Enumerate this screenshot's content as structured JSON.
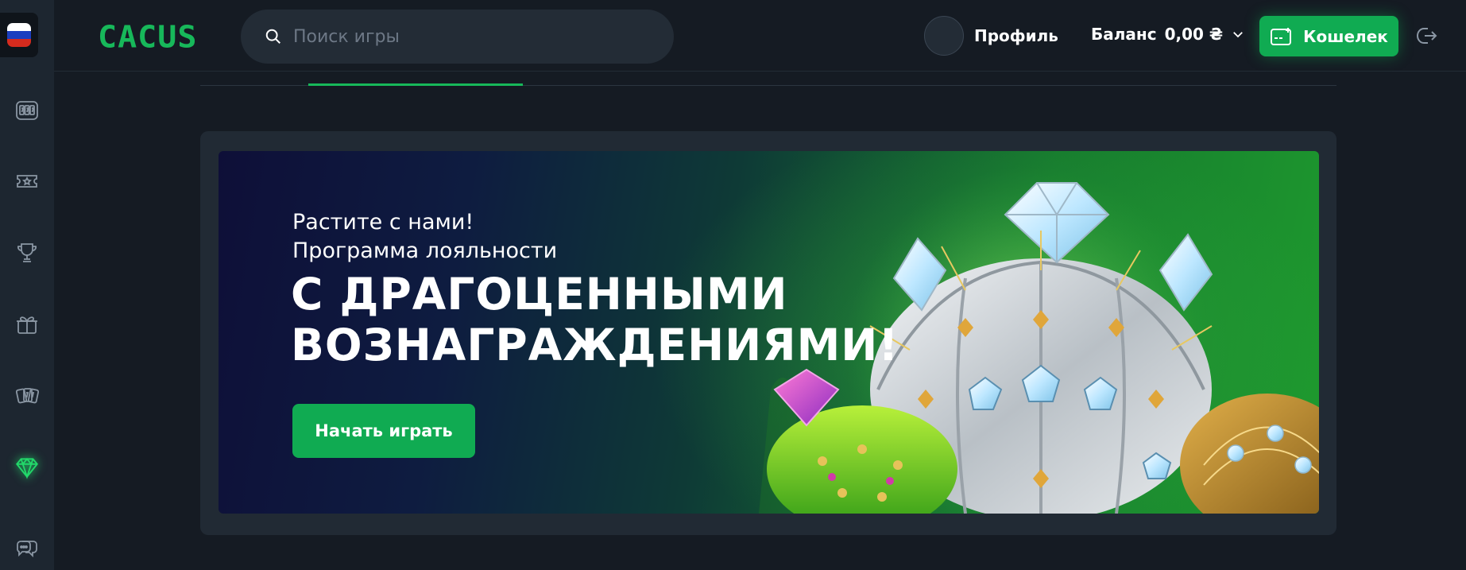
{
  "sidebar": {
    "language_flag": {
      "name": "russia-flag-icon",
      "colors": [
        "#ffffff",
        "#1c3fbf",
        "#d52b1e"
      ]
    },
    "items": [
      {
        "icon": "slot-machine-icon"
      },
      {
        "icon": "ticket-star-icon"
      },
      {
        "icon": "trophy-icon"
      },
      {
        "icon": "gift-box-icon"
      },
      {
        "icon": "dice-cards-icon"
      },
      {
        "icon": "diamond-icon",
        "active": true
      },
      {
        "icon": "chat-icon"
      }
    ]
  },
  "header": {
    "logo_text": "CACUS",
    "search": {
      "placeholder": "Поиск игры",
      "icon": "search-icon"
    },
    "profile_label": "Профиль",
    "balance_label": "Баланс",
    "balance_value": "0,00 ₴",
    "wallet_label": "Кошелек",
    "wallet_icon": "wallet-icon",
    "logout_icon": "logout-icon"
  },
  "banner": {
    "subtitle_line1": "Растите с нами!",
    "subtitle_line2": "Программа лояльности",
    "title_line1": "С ДРАГОЦЕННЫМИ",
    "title_line2": "ВОЗНАГРАЖДЕНИЯМИ!",
    "cta_label": "Начать играть"
  },
  "colors": {
    "accent": "#10ab52",
    "logo": "#17b85a",
    "background": "#151b23",
    "panel": "#212a34"
  }
}
